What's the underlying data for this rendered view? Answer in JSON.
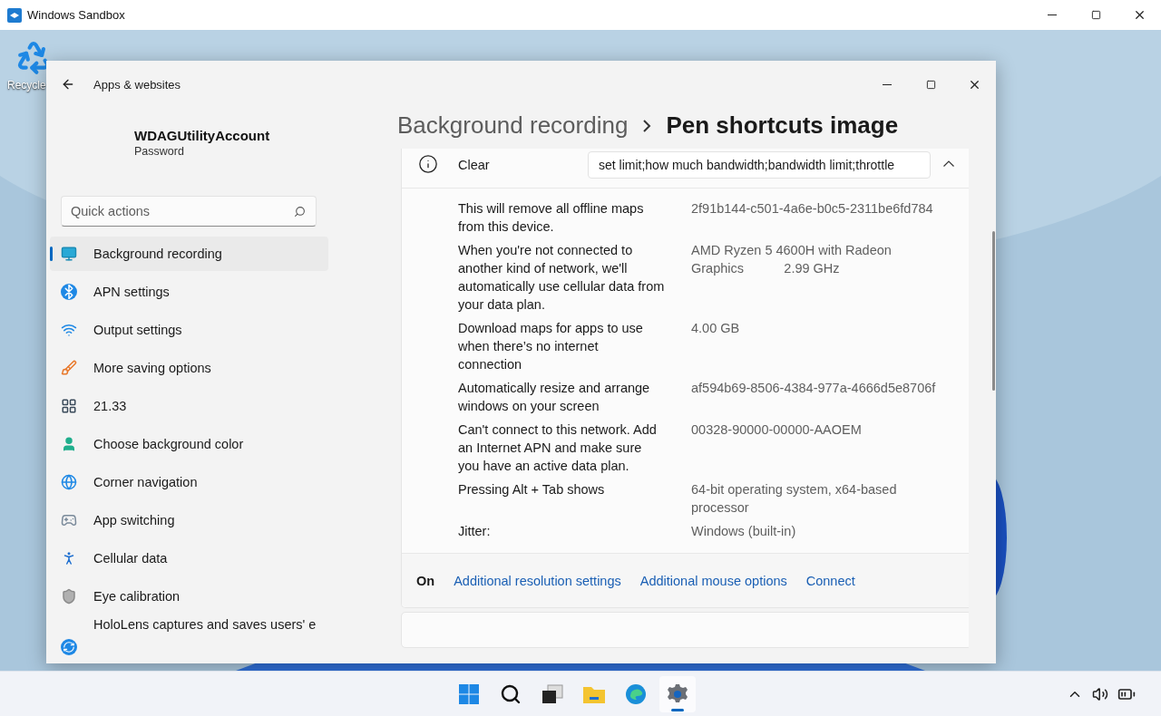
{
  "window": {
    "title": "Windows Sandbox"
  },
  "desktop_icons": [
    {
      "label": "Recycle"
    }
  ],
  "settings": {
    "nav_title": "Apps & websites",
    "account": {
      "name": "WDAGUtilityAccount",
      "subtitle": "Password"
    },
    "search": {
      "placeholder": "Quick actions"
    },
    "nav_items": [
      {
        "label": "Background recording",
        "selected": true
      },
      {
        "label": "APN settings",
        "selected": false
      },
      {
        "label": "Output settings",
        "selected": false
      },
      {
        "label": "More saving options",
        "selected": false
      },
      {
        "label": "21.33",
        "selected": false
      },
      {
        "label": "Choose background color",
        "selected": false
      },
      {
        "label": "Corner navigation",
        "selected": false
      },
      {
        "label": "App switching",
        "selected": false
      },
      {
        "label": "Cellular data",
        "selected": false
      },
      {
        "label": "Eye calibration",
        "selected": false
      },
      {
        "label": "HoloLens captures and saves users' e",
        "selected": false
      }
    ],
    "breadcrumb": [
      "Background recording",
      "Pen shortcuts image"
    ],
    "card": {
      "label": "Clear",
      "field_value": "set limit;how much bandwidth;bandwidth limit;throttle",
      "expanded": true,
      "details": [
        {
          "label": "This will remove all offline maps from this device.",
          "value": "2f91b144-c501-4a6e-b0c5-2311be6fd784"
        },
        {
          "label": "When you're not connected to another kind of network, we'll automatically use cellular data from your data plan.",
          "value": "AMD Ryzen 5 4600H with Radeon Graphics           2.99 GHz"
        },
        {
          "label": "Download maps for apps to use when there’s no internet connection",
          "value": "4.00 GB"
        },
        {
          "label": "Automatically resize and arrange windows on your screen",
          "value": "af594b69-8506-4384-977a-4666d5e8706f"
        },
        {
          "label": "Can't connect to this network. Add an Internet APN and make sure you have an active data plan.",
          "value": "00328-90000-00000-AAOEM"
        },
        {
          "label": "Pressing Alt + Tab shows",
          "value": "64-bit operating system, x64-based processor"
        },
        {
          "label": "Jitter:",
          "value": "Windows (built-in)"
        }
      ],
      "footer_state": "On",
      "links": [
        "Additional resolution settings",
        "Additional mouse options",
        "Connect"
      ]
    }
  },
  "taskbar": [
    {
      "kind": "start",
      "selected": false
    },
    {
      "kind": "search",
      "selected": false
    },
    {
      "kind": "taskview",
      "selected": false
    },
    {
      "kind": "explorer",
      "selected": false
    },
    {
      "kind": "edge",
      "selected": false
    },
    {
      "kind": "settings",
      "selected": true
    }
  ]
}
